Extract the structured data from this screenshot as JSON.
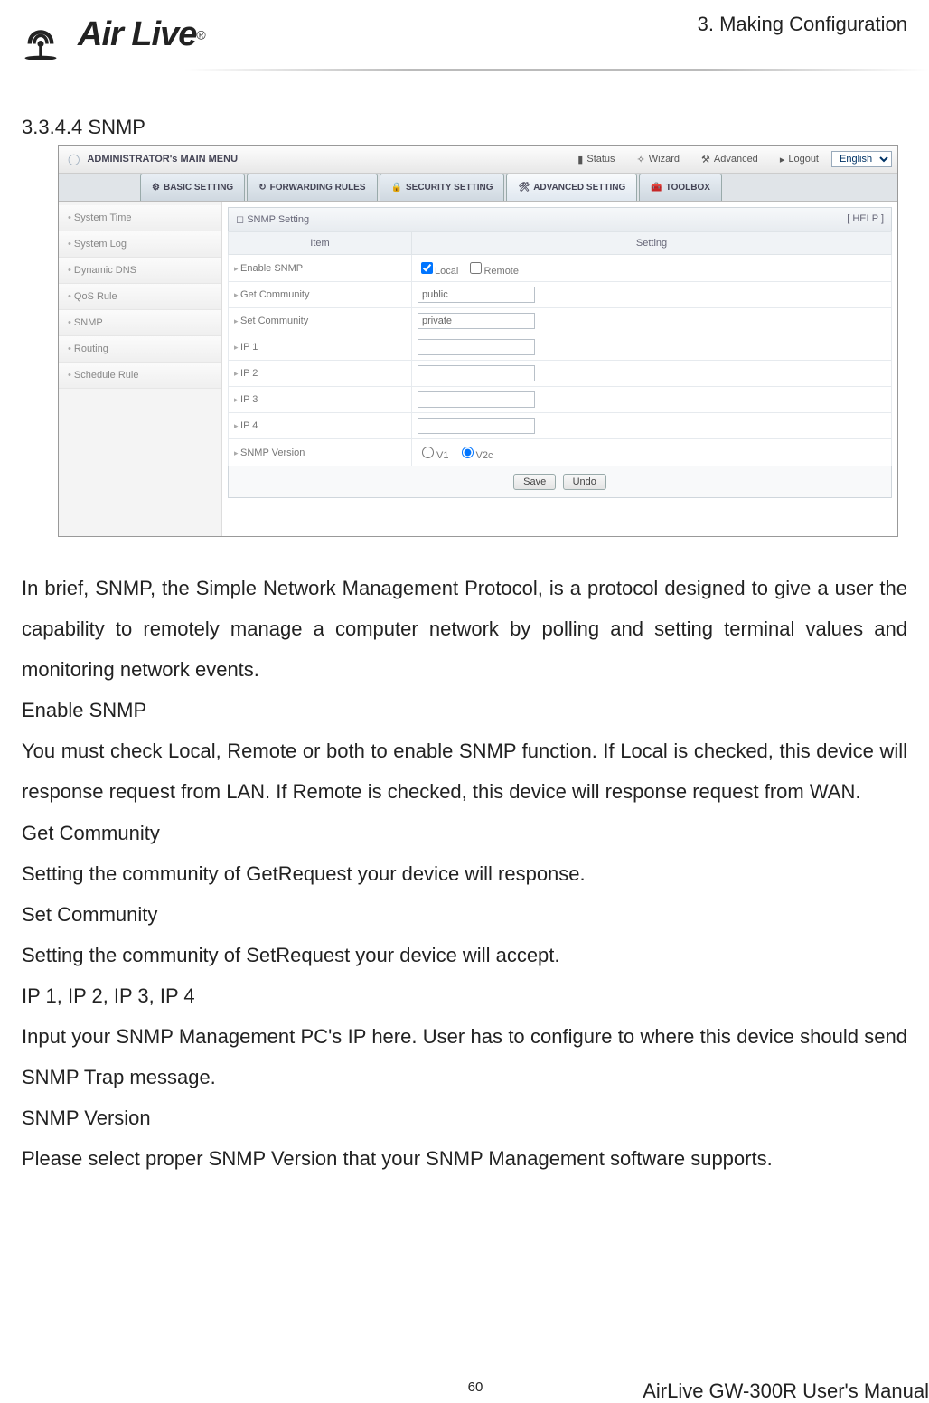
{
  "header": {
    "chapter": "3. Making Configuration",
    "logo_text": "Air Live",
    "logo_reg": "®"
  },
  "section_heading": "3.3.4.4 SNMP",
  "screenshot": {
    "topmenu": {
      "main_label": "ADMINISTRATOR's MAIN MENU",
      "items": [
        "Status",
        "Wizard",
        "Advanced",
        "Logout"
      ],
      "language": "English"
    },
    "tabs": [
      "BASIC SETTING",
      "FORWARDING RULES",
      "SECURITY SETTING",
      "ADVANCED SETTING",
      "TOOLBOX"
    ],
    "active_tab_index": 3,
    "sidebar": [
      "System Time",
      "System Log",
      "Dynamic DNS",
      "QoS Rule",
      "SNMP",
      "Routing",
      "Schedule Rule"
    ],
    "panel": {
      "title": "SNMP Setting",
      "help": "[ HELP ]",
      "header_item": "Item",
      "header_setting": "Setting",
      "rows": {
        "enable_label": "Enable SNMP",
        "enable_local": "Local",
        "enable_local_checked": true,
        "enable_remote": "Remote",
        "enable_remote_checked": false,
        "get_label": "Get Community",
        "get_value": "public",
        "set_label": "Set Community",
        "set_value": "private",
        "ip1_label": "IP 1",
        "ip1_value": "",
        "ip2_label": "IP 2",
        "ip2_value": "",
        "ip3_label": "IP 3",
        "ip3_value": "",
        "ip4_label": "IP 4",
        "ip4_value": "",
        "version_label": "SNMP Version",
        "version_v1": "V1",
        "version_v2c": "V2c",
        "version_selected": "V2c"
      },
      "save": "Save",
      "undo": "Undo"
    }
  },
  "body": {
    "p1": "In brief, SNMP, the Simple Network Management Protocol, is a protocol designed to give a user the capability to remotely manage a computer network by polling and setting terminal values and monitoring network events.",
    "h_enable": "Enable SNMP",
    "p_enable": "You must check Local, Remote or both to enable SNMP function. If Local is checked, this device will response request from LAN. If Remote is checked, this device will response request from WAN.",
    "h_get": "Get Community",
    "p_get": "Setting the community of GetRequest your device will response.",
    "h_set": "Set Community",
    "p_set": "Setting the community of SetRequest your device will accept.",
    "h_ip": "IP 1, IP 2, IP 3, IP 4",
    "p_ip": "Input your SNMP Management PC's IP here. User has to configure to where this device should send SNMP Trap message.",
    "h_ver": "SNMP Version",
    "p_ver": "Please select proper SNMP Version that your SNMP Management software supports."
  },
  "footer": {
    "page": "60",
    "manual": "AirLive GW-300R User's Manual"
  }
}
